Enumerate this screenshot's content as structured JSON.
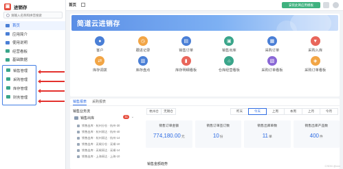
{
  "app": {
    "name": "进销存"
  },
  "search": {
    "placeholder": "请输入名称和拼音搜索"
  },
  "sidebar": {
    "items": [
      {
        "label": "首页"
      },
      {
        "label": "应用简介"
      },
      {
        "label": "使用说明"
      },
      {
        "label": "经营看板"
      },
      {
        "label": "基础数据"
      }
    ],
    "highlighted_group": [
      {
        "label": "销售管理"
      },
      {
        "label": "采购管理"
      },
      {
        "label": "库存管理"
      },
      {
        "label": "财务管理"
      }
    ]
  },
  "topbar": {
    "home_tab": "首页",
    "install_button": "安装此简应用模板"
  },
  "banner": {
    "title": "简道云进销存"
  },
  "quick_actions": [
    {
      "label": "客户",
      "icon": "person-icon",
      "color": "#4a7fd6",
      "glyph": "●"
    },
    {
      "label": "跟进记录",
      "icon": "clock-icon",
      "color": "#f2a545",
      "glyph": "◷"
    },
    {
      "label": "销售订单",
      "icon": "order-icon",
      "color": "#4a7fd6",
      "glyph": "▤"
    },
    {
      "label": "销售出库",
      "icon": "truck-icon",
      "color": "#3aa58a",
      "glyph": "▣"
    },
    {
      "label": "采购订单",
      "icon": "cart-icon",
      "color": "#4a7fd6",
      "glyph": "▦"
    },
    {
      "label": "采购入库",
      "icon": "inbound-icon",
      "color": "#e9665b",
      "glyph": "▼"
    },
    {
      "label": "库存调拨",
      "icon": "transfer-icon",
      "color": "#f2a545",
      "glyph": "⇄"
    },
    {
      "label": "库存盘点",
      "icon": "inventory-icon",
      "color": "#4a7fd6",
      "glyph": "▥"
    },
    {
      "label": "库存明细看板",
      "icon": "chart-icon",
      "color": "#e9665b",
      "glyph": "▮"
    },
    {
      "label": "仓库经营看板",
      "icon": "warehouse-icon",
      "color": "#3aa58a",
      "glyph": "⌂"
    },
    {
      "label": "采购订单看板",
      "icon": "board-icon",
      "color": "#8a67d6",
      "glyph": "▧"
    },
    {
      "label": "采购订单看板",
      "icon": "ticket-icon",
      "color": "#f2a545",
      "glyph": "◈"
    }
  ],
  "stats": {
    "tabs": [
      "销售报表",
      "采购报表"
    ],
    "active_tab": 0,
    "left_title": "销售业务流",
    "left_item": {
      "label": "销售出库",
      "badge": "11"
    },
    "tree": [
      "销售出库 · 杭州分仓 · 杭州-30",
      "销售出库 · 杭州易达 · 杭州-40",
      "销售出库 · 杭州易达 · 杭州-14",
      "销售出库 · 无锡分仓 · 无锡-10",
      "销售出库 · 无锡易达 · 无锡-14",
      "销售出库 · 上海易达 · 上海-10"
    ],
    "cities": [
      "杭州仓",
      "无锡仓"
    ],
    "periods": [
      "昨天",
      "今天",
      "上周",
      "本周",
      "上月",
      "今月"
    ],
    "selected_period": 1,
    "metrics": [
      {
        "label": "销售订单金额",
        "value": "774,180.00",
        "unit": "元"
      },
      {
        "label": "销售订单签订数",
        "value": "10",
        "unit": "份"
      },
      {
        "label": "销售出库单数",
        "value": "11",
        "unit": "单"
      },
      {
        "label": "销售出库产品数",
        "value": "400",
        "unit": "件"
      }
    ],
    "trend_title": "销售金额趋势"
  },
  "watermark": "CSDN @xxx"
}
